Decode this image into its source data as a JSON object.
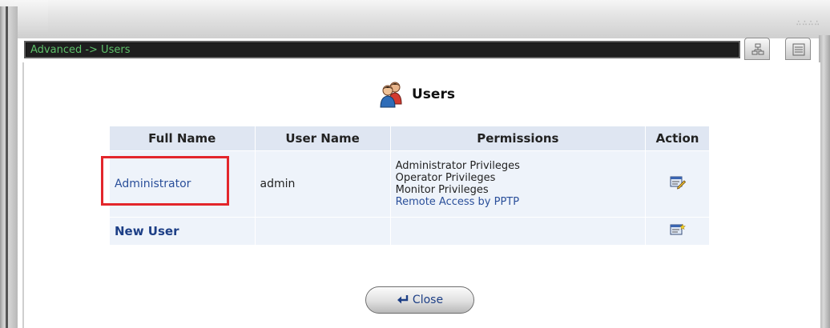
{
  "window": {
    "breadcrumb": "Advanced -> Users",
    "grip": "∴∴∴∴"
  },
  "page": {
    "title": "Users"
  },
  "table": {
    "headers": [
      "Full Name",
      "User Name",
      "Permissions",
      "Action"
    ],
    "rows": [
      {
        "full_name": "Administrator",
        "user_name": "admin",
        "permissions": [
          "Administrator Privileges",
          "Operator Privileges",
          "Monitor Privileges",
          "Remote Access by PPTP"
        ],
        "action_icon": "edit-icon"
      }
    ],
    "new_user_label": "New User",
    "new_user_action_icon": "add-user-icon"
  },
  "footer": {
    "close_label": "Close"
  },
  "colors": {
    "titlebar_text": "#5ec06a",
    "highlight": "#e3262b",
    "link": "#2a4f9a"
  }
}
